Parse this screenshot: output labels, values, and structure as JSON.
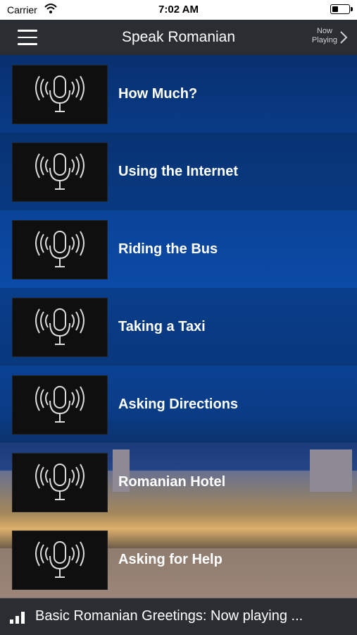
{
  "status_bar": {
    "carrier": "Carrier",
    "time": "7:02 AM",
    "wifi_icon": "wifi-icon",
    "battery_icon": "battery-icon"
  },
  "nav": {
    "title": "Speak Romanian",
    "now_playing_line1": "Now",
    "now_playing_line2": "Playing",
    "menu_icon": "hamburger-menu-icon",
    "chevron_icon": "chevron-right-icon"
  },
  "list": {
    "items": [
      {
        "label": "How Much?",
        "icon": "microphone-broadcast-icon"
      },
      {
        "label": "Using the Internet",
        "icon": "microphone-broadcast-icon"
      },
      {
        "label": "Riding the Bus",
        "icon": "microphone-broadcast-icon"
      },
      {
        "label": "Taking a Taxi",
        "icon": "microphone-broadcast-icon"
      },
      {
        "label": "Asking Directions",
        "icon": "microphone-broadcast-icon"
      },
      {
        "label": "Romanian Hotel",
        "icon": "microphone-broadcast-icon"
      },
      {
        "label": "Asking for Help",
        "icon": "microphone-broadcast-icon"
      }
    ]
  },
  "footer": {
    "now_playing_text": "Basic Romanian Greetings: Now playing ...",
    "icon": "audio-bars-icon"
  },
  "colors": {
    "nav_bg": "#2a2d31",
    "list_blue": "#0a3f8e",
    "thumb_bg": "#0f0f10"
  }
}
